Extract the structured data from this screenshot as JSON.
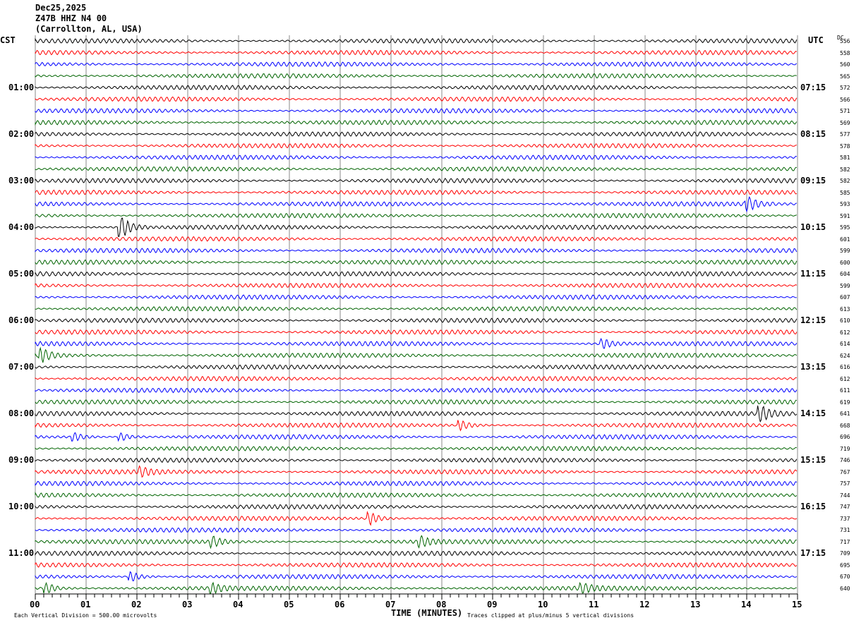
{
  "header": {
    "date": "Dec25,2025",
    "station": "Z47B HHZ N4 00",
    "location": "(Carrollton, AL, USA)"
  },
  "left_tz": "CST",
  "right_tz": "UTC",
  "dc_label": "DC",
  "chart_data": {
    "type": "line",
    "title": "Helicorder Z47B HHZ N4 00",
    "xlabel": "TIME (MINUTES)",
    "xlim": [
      0,
      15
    ],
    "x_ticks": [
      "00",
      "01",
      "02",
      "03",
      "04",
      "05",
      "06",
      "07",
      "08",
      "09",
      "10",
      "11",
      "12",
      "13",
      "14",
      "15"
    ],
    "lines_per_hour": 4,
    "trace_count": 48,
    "trace_colors": [
      "#000000",
      "#ff0000",
      "#0000ff",
      "#006400"
    ],
    "left_hour_labels": [
      "01:00",
      "02:00",
      "03:00",
      "04:00",
      "05:00",
      "06:00",
      "07:00",
      "08:00",
      "09:00",
      "10:00",
      "11:00"
    ],
    "right_hour_labels": [
      "07:15",
      "08:15",
      "09:15",
      "10:15",
      "11:15",
      "12:15",
      "13:15",
      "14:15",
      "15:15",
      "16:15",
      "17:15"
    ],
    "dc_offsets": [
      556,
      558,
      560,
      565,
      572,
      566,
      571,
      569,
      577,
      578,
      581,
      582,
      582,
      585,
      593,
      591,
      595,
      601,
      599,
      600,
      604,
      599,
      607,
      613,
      610,
      612,
      614,
      624,
      616,
      612,
      611,
      619,
      641,
      668,
      696,
      719,
      746,
      767,
      757,
      744,
      747,
      737,
      731,
      717,
      709,
      695,
      670,
      640
    ],
    "events": [
      {
        "trace": 16,
        "minute": 1.7,
        "amp": 4
      },
      {
        "trace": 14,
        "minute": 14.05,
        "amp": 2
      },
      {
        "trace": 27,
        "minute": 0.15,
        "amp": 2
      },
      {
        "trace": 26,
        "minute": 11.2,
        "amp": 1.5
      },
      {
        "trace": 32,
        "minute": 14.3,
        "amp": 2.2
      },
      {
        "trace": 33,
        "minute": 8.4,
        "amp": 1.5
      },
      {
        "trace": 34,
        "minute": 0.8,
        "amp": 1.3
      },
      {
        "trace": 34,
        "minute": 1.7,
        "amp": 1.3
      },
      {
        "trace": 37,
        "minute": 2.1,
        "amp": 1.3
      },
      {
        "trace": 41,
        "minute": 6.6,
        "amp": 2
      },
      {
        "trace": 43,
        "minute": 3.5,
        "amp": 1.6
      },
      {
        "trace": 43,
        "minute": 7.6,
        "amp": 1.6
      },
      {
        "trace": 46,
        "minute": 1.9,
        "amp": 1.6
      },
      {
        "trace": 47,
        "minute": 0.25,
        "amp": 1.6
      },
      {
        "trace": 47,
        "minute": 3.5,
        "amp": 1.4
      },
      {
        "trace": 47,
        "minute": 10.8,
        "amp": 1.2
      }
    ],
    "scale_note": "Each Vertical Division =  500.00 microvolts",
    "clip_note": "Traces clipped at plus/minus 5 vertical divisions"
  }
}
